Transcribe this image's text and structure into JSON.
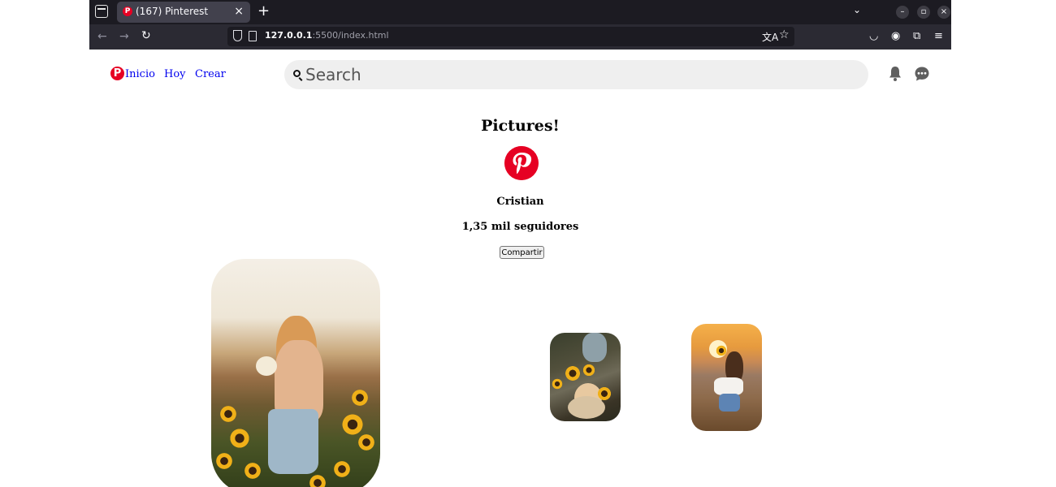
{
  "browser": {
    "tab_title": "(167) Pinterest",
    "tab_favicon": "pinterest-icon",
    "url_host": "127.0.0.1",
    "url_path": ":5500/index.html"
  },
  "header": {
    "logo_letter": "P",
    "nav": [
      "Inicio",
      "Hoy",
      "Crear"
    ],
    "search_placeholder": "Search",
    "icons": [
      "bell-icon",
      "chat-icon"
    ]
  },
  "profile": {
    "title": "Pictures!",
    "name": "Cristian",
    "followers": "1,35 mil seguidores",
    "share_label": "Compartir"
  },
  "colors": {
    "brand": "#e60023",
    "link": "#0000ee",
    "search_bg": "#efefef"
  },
  "pins": [
    {
      "subject": "woman-in-sunflower-field"
    },
    {
      "subject": "woman-with-sunflowers-lying"
    },
    {
      "subject": "woman-in-wheat-field-sunset"
    }
  ]
}
